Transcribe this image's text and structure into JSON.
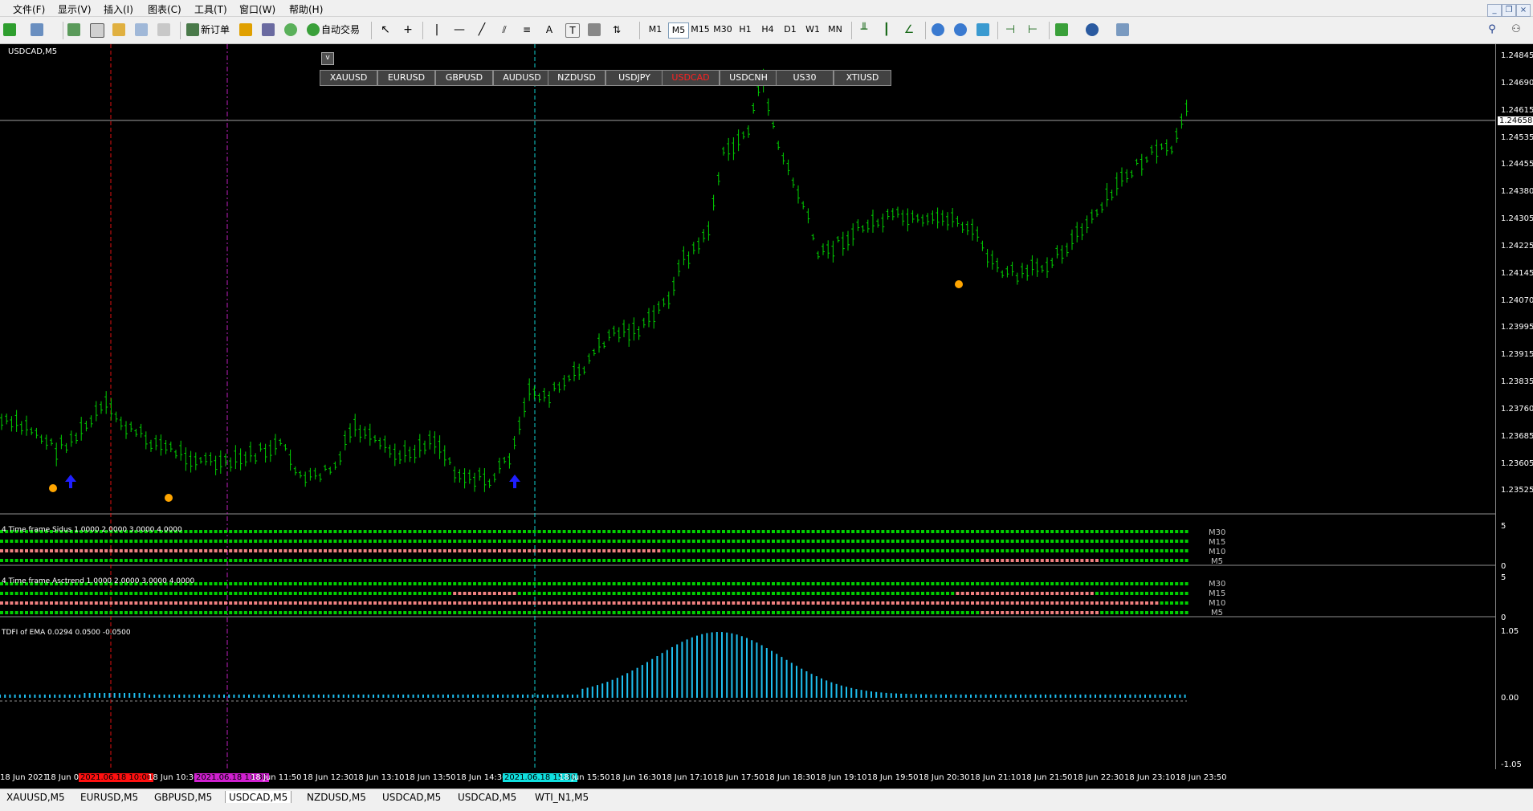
{
  "menu": {
    "items": [
      "文件(F)",
      "显示(V)",
      "插入(I)",
      "图表(C)",
      "工具(T)",
      "窗口(W)",
      "帮助(H)"
    ]
  },
  "toolbar": {
    "new_order": "新订单",
    "auto_trading": "自动交易",
    "timeframes": [
      "M1",
      "M5",
      "M15",
      "M30",
      "H1",
      "H4",
      "D1",
      "W1",
      "MN"
    ],
    "active_timeframe": "M5"
  },
  "chart": {
    "title": "USDCAD,M5",
    "current_price": "1.24658",
    "collapse_button": "v",
    "symbol_buttons": [
      "XAUUSD",
      "EURUSD",
      "GBPUSD",
      "AUDUSD",
      "NZDUSD",
      "USDJPY",
      "USDCAD",
      "USDCNH",
      "US30",
      "XTIUSD"
    ],
    "active_symbol": "USDCAD",
    "price_levels": [
      "1.24845",
      "1.24690",
      "1.24615",
      "1.24535",
      "1.24455",
      "1.24380",
      "1.24305",
      "1.24225",
      "1.24145",
      "1.24070",
      "1.23995",
      "1.23915",
      "1.23835",
      "1.23760",
      "1.23685",
      "1.23605",
      "1.23525"
    ],
    "colors": {
      "candle": "#00d000",
      "dot": "#ffa500",
      "arrow": "#1f1fff",
      "ema": "#1ec0f0"
    }
  },
  "panel1": {
    "title": "4 Time frame Sidus 1.0000 2.0000 3.0000 4.0000",
    "rows": [
      "M30",
      "M15",
      "M10",
      "M5"
    ],
    "scale": [
      "5",
      "0"
    ]
  },
  "panel2": {
    "title": "4 Time frame Asctrend 1.0000 2.0000 3.0000 4.0000",
    "rows": [
      "M30",
      "M15",
      "M10",
      "M5"
    ],
    "scale": [
      "5",
      "0"
    ]
  },
  "panel3": {
    "title": "TDFI of EMA 0.0294 0.0500 -0.0500",
    "scale": [
      "1.05",
      "0.00",
      "-1.05"
    ]
  },
  "time_axis": {
    "labels": [
      "18 Jun 2021",
      "18 Jun 09:50",
      "2021.06.18 10:00",
      "18 Jun 10:30",
      "2021.06.18 11:30",
      "18 Jun 11:50",
      "18 Jun 12:30",
      "18 Jun 13:10",
      "18 Jun 13:50",
      "18 Jun 14:30",
      "2021.06.18 15:30",
      "18 Jun 15:50",
      "18 Jun 16:30",
      "18 Jun 17:10",
      "18 Jun 17:50",
      "18 Jun 18:30",
      "18 Jun 19:10",
      "18 Jun 19:50",
      "18 Jun 20:30",
      "18 Jun 21:10",
      "18 Jun 21:50",
      "18 Jun 22:30",
      "18 Jun 23:10",
      "18 Jun 23:50"
    ]
  },
  "tabs": [
    "XAUUSD,M5",
    "EURUSD,M5",
    "GBPUSD,M5",
    "USDCAD,M5",
    "NZDUSD,M5",
    "USDCAD,M5",
    "USDCAD,M5",
    "WTI_N1,M5"
  ],
  "active_tab": "USDCAD,M5"
}
